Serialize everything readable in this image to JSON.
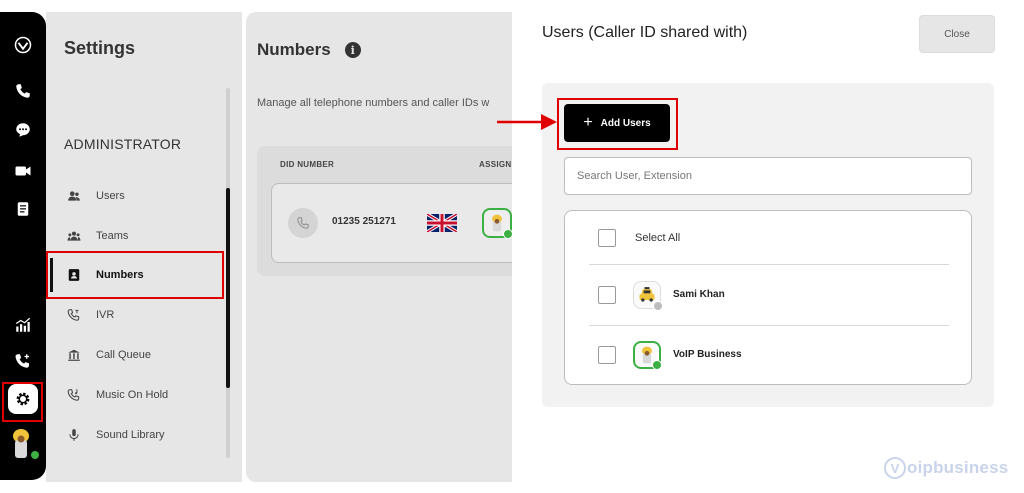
{
  "settings": {
    "title": "Settings",
    "section_label": "ADMINISTRATOR",
    "nav": [
      {
        "label": "Users",
        "icon": "users-icon"
      },
      {
        "label": "Teams",
        "icon": "teams-icon"
      },
      {
        "label": "Numbers",
        "icon": "contact-card-icon",
        "active": true
      },
      {
        "label": "IVR",
        "icon": "ivr-icon"
      },
      {
        "label": "Call Queue",
        "icon": "call-queue-icon"
      },
      {
        "label": "Music On Hold",
        "icon": "music-on-hold-icon"
      },
      {
        "label": "Sound Library",
        "icon": "microphone-icon"
      }
    ]
  },
  "numbers": {
    "title": "Numbers",
    "description": "Manage all telephone numbers and caller IDs w",
    "columns": [
      "DID NUMBER",
      "ASSIGN"
    ],
    "rows": [
      {
        "did": "01235 251271",
        "flag": "uk-flag"
      }
    ]
  },
  "drawer": {
    "title": "Users (Caller ID shared with)",
    "close_label": "Close",
    "add_users_label": "Add Users",
    "search_placeholder": "Search User, Extension",
    "select_all_label": "Select All",
    "users": [
      {
        "name": "Sami Khan",
        "status": "offline",
        "status_color": "#bdbdbd"
      },
      {
        "name": "VoIP Business",
        "status": "online",
        "status_color": "#3cb043"
      }
    ]
  },
  "watermark": {
    "text": "oipbusiness",
    "mark": "V"
  },
  "colors": {
    "accent": "#000000",
    "highlight": "#e00000",
    "online": "#3cb043",
    "panel": "#e6e6e6"
  }
}
